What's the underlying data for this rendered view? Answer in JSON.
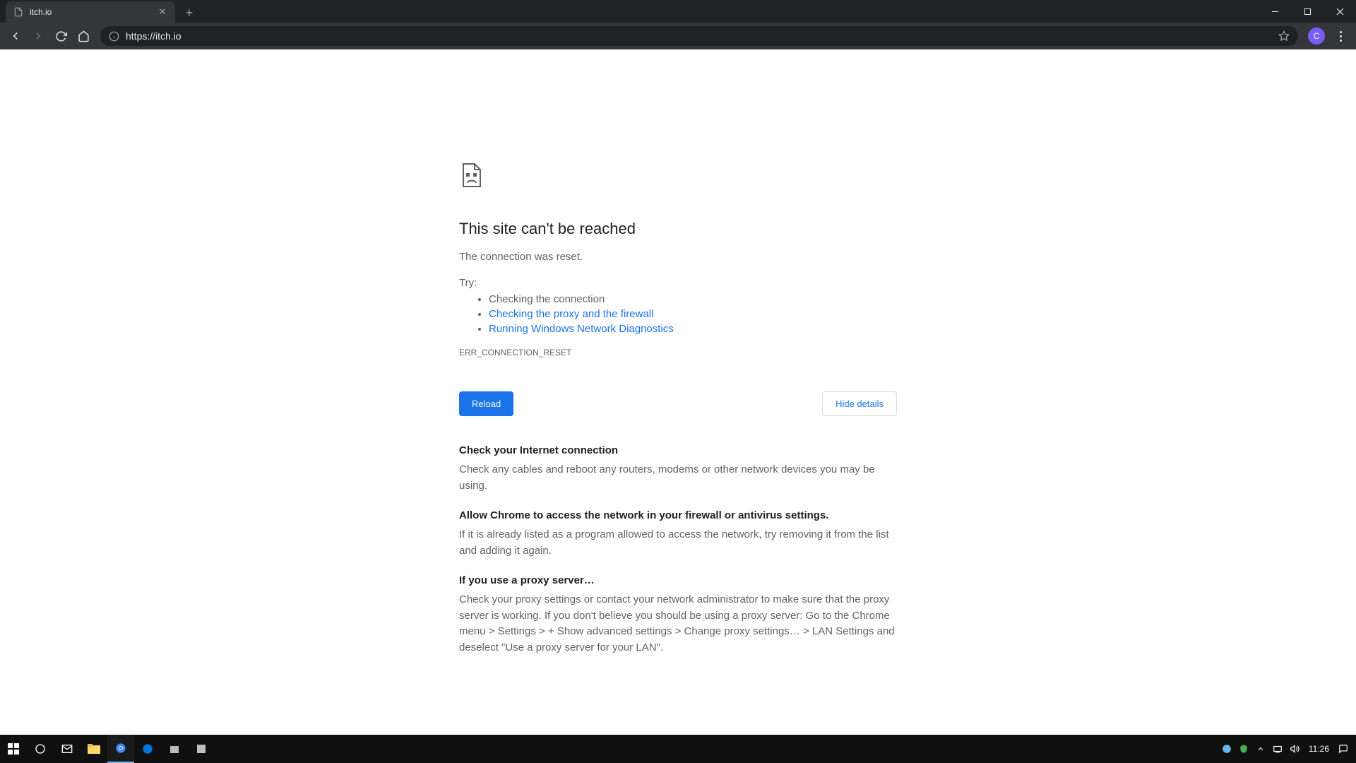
{
  "browser": {
    "tab_title": "itch.io",
    "url": "https://itch.io",
    "avatar_initial": "C"
  },
  "error": {
    "title": "This site can't be reached",
    "subtitle": "The connection was reset.",
    "try_label": "Try:",
    "suggestions": {
      "check_conn": "Checking the connection",
      "check_proxy": "Checking the proxy and the firewall",
      "run_diag": "Running Windows Network Diagnostics"
    },
    "code": "ERR_CONNECTION_RESET",
    "reload_label": "Reload",
    "hide_label": "Hide details",
    "details": {
      "d1_title": "Check your Internet connection",
      "d1_body": "Check any cables and reboot any routers, modems or other network devices you may be using.",
      "d2_title": "Allow Chrome to access the network in your firewall or antivirus settings.",
      "d2_body": "If it is already listed as a program allowed to access the network, try removing it from the list and adding it again.",
      "d3_title": "If you use a proxy server…",
      "d3_body": "Check your proxy settings or contact your network administrator to make sure that the proxy server is working. If you don't believe you should be using a proxy server: Go to the Chrome menu > Settings > + Show advanced settings > Change proxy settings… > LAN Settings and deselect \"Use a proxy server for your LAN\"."
    }
  },
  "taskbar": {
    "clock": "11:26"
  }
}
